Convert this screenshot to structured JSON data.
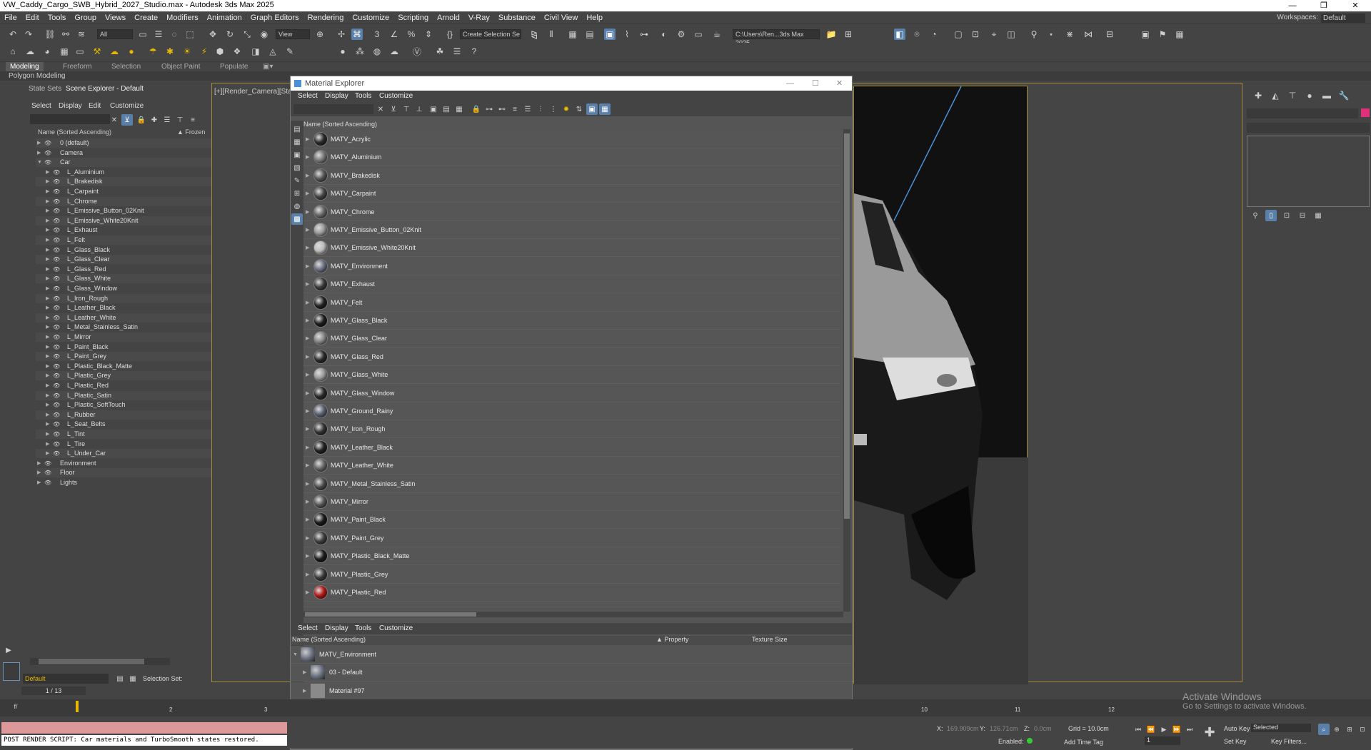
{
  "window": {
    "title": "VW_Caddy_Cargo_SWB_Hybrid_2027_Studio.max - Autodesk 3ds Max 2025"
  },
  "menubar": {
    "items": [
      "File",
      "Edit",
      "Tools",
      "Group",
      "Views",
      "Create",
      "Modifiers",
      "Animation",
      "Graph Editors",
      "Rendering",
      "Customize",
      "Scripting",
      "Arnold",
      "V-Ray",
      "Substance",
      "Civil View",
      "Help"
    ],
    "workspaces_label": "Workspaces:",
    "workspace_value": "Default"
  },
  "toolbar": {
    "selection_filter": "All",
    "ref_coord": "View",
    "named_sel": "Create Selection Se",
    "project_path": "C:\\Users\\Ren...3ds Max 2025"
  },
  "ribbon": {
    "tabs": [
      "Modeling",
      "Freeform",
      "Selection",
      "Object Paint",
      "Populate"
    ],
    "sub": "Polygon Modeling"
  },
  "scene_explorer": {
    "tabs": [
      "State Sets",
      "Scene Explorer - Default"
    ],
    "menu": [
      "Select",
      "Display",
      "Edit",
      "Customize"
    ],
    "col_name": "Name (Sorted Ascending)",
    "col_frozen": "▲ Frozen",
    "rows": [
      {
        "label": "0 (default)",
        "level": 1,
        "exp": "▶"
      },
      {
        "label": "Camera",
        "level": 1,
        "exp": "▶"
      },
      {
        "label": "Car",
        "level": 1,
        "exp": "▼"
      },
      {
        "label": "L_Aluminium",
        "level": 2,
        "exp": "▶"
      },
      {
        "label": "L_Brakedisk",
        "level": 2,
        "exp": "▶"
      },
      {
        "label": "L_Carpaint",
        "level": 2,
        "exp": "▶"
      },
      {
        "label": "L_Chrome",
        "level": 2,
        "exp": "▶"
      },
      {
        "label": "L_Emissive_Button_02Knit",
        "level": 2,
        "exp": "▶"
      },
      {
        "label": "L_Emissive_White20Knit",
        "level": 2,
        "exp": "▶"
      },
      {
        "label": "L_Exhaust",
        "level": 2,
        "exp": "▶"
      },
      {
        "label": "L_Felt",
        "level": 2,
        "exp": "▶"
      },
      {
        "label": "L_Glass_Black",
        "level": 2,
        "exp": "▶"
      },
      {
        "label": "L_Glass_Clear",
        "level": 2,
        "exp": "▶"
      },
      {
        "label": "L_Glass_Red",
        "level": 2,
        "exp": "▶"
      },
      {
        "label": "L_Glass_White",
        "level": 2,
        "exp": "▶"
      },
      {
        "label": "L_Glass_Window",
        "level": 2,
        "exp": "▶"
      },
      {
        "label": "L_Iron_Rough",
        "level": 2,
        "exp": "▶"
      },
      {
        "label": "L_Leather_Black",
        "level": 2,
        "exp": "▶"
      },
      {
        "label": "L_Leather_White",
        "level": 2,
        "exp": "▶"
      },
      {
        "label": "L_Metal_Stainless_Satin",
        "level": 2,
        "exp": "▶"
      },
      {
        "label": "L_Mirror",
        "level": 2,
        "exp": "▶"
      },
      {
        "label": "L_Paint_Black",
        "level": 2,
        "exp": "▶"
      },
      {
        "label": "L_Paint_Grey",
        "level": 2,
        "exp": "▶"
      },
      {
        "label": "L_Plastic_Black_Matte",
        "level": 2,
        "exp": "▶"
      },
      {
        "label": "L_Plastic_Grey",
        "level": 2,
        "exp": "▶"
      },
      {
        "label": "L_Plastic_Red",
        "level": 2,
        "exp": "▶"
      },
      {
        "label": "L_Plastic_Satin",
        "level": 2,
        "exp": "▶"
      },
      {
        "label": "L_Plastic_SoftTouch",
        "level": 2,
        "exp": "▶"
      },
      {
        "label": "L_Rubber",
        "level": 2,
        "exp": "▶"
      },
      {
        "label": "L_Seat_Belts",
        "level": 2,
        "exp": "▶"
      },
      {
        "label": "L_Tint",
        "level": 2,
        "exp": "▶"
      },
      {
        "label": "L_Tire",
        "level": 2,
        "exp": "▶"
      },
      {
        "label": "L_Under_Car",
        "level": 2,
        "exp": "▶"
      },
      {
        "label": "Environment",
        "level": 1,
        "exp": "▶"
      },
      {
        "label": "Floor",
        "level": 1,
        "exp": "▶"
      },
      {
        "label": "Lights",
        "level": 1,
        "exp": "▶"
      }
    ],
    "layer_value": "Default",
    "selection_set_label": "Selection Set:"
  },
  "viewport": {
    "label": "[+][Render_Camera][Stan"
  },
  "material_explorer": {
    "title": "Material Explorer",
    "menu": [
      "Select",
      "Display",
      "Tools",
      "Customize"
    ],
    "col_name": "Name (Sorted Ascending)",
    "materials": [
      {
        "name": "MATV_Acrylic",
        "color": "#2a2a2a"
      },
      {
        "name": "MATV_Aluminium",
        "color": "#777777"
      },
      {
        "name": "MATV_Brakedisk",
        "color": "#555555"
      },
      {
        "name": "MATV_Carpaint",
        "color": "#444444"
      },
      {
        "name": "MATV_Chrome",
        "color": "#666666"
      },
      {
        "name": "MATV_Emissive_Button_02Knit",
        "color": "#999999"
      },
      {
        "name": "MATV_Emissive_White20Knit",
        "color": "#bbbbbb"
      },
      {
        "name": "MATV_Environment",
        "color": "#6a7080"
      },
      {
        "name": "MATV_Exhaust",
        "color": "#3a3a3a"
      },
      {
        "name": "MATV_Felt",
        "color": "#222222"
      },
      {
        "name": "MATV_Glass_Black",
        "color": "#1e1e1e"
      },
      {
        "name": "MATV_Glass_Clear",
        "color": "#888888"
      },
      {
        "name": "MATV_Glass_Red",
        "color": "#2b2b2b"
      },
      {
        "name": "MATV_Glass_White",
        "color": "#9a9a9a"
      },
      {
        "name": "MATV_Glass_Window",
        "color": "#2a2a2a"
      },
      {
        "name": "MATV_Ground_Rainy",
        "color": "#5a6070"
      },
      {
        "name": "MATV_Iron_Rough",
        "color": "#333333"
      },
      {
        "name": "MATV_Leather_Black",
        "color": "#222222"
      },
      {
        "name": "MATV_Leather_White",
        "color": "#666666"
      },
      {
        "name": "MATV_Metal_Stainless_Satin",
        "color": "#4a4a4a"
      },
      {
        "name": "MATV_Mirror",
        "color": "#555555"
      },
      {
        "name": "MATV_Paint_Black",
        "color": "#1a1a1a"
      },
      {
        "name": "MATV_Paint_Grey",
        "color": "#3e3e3e"
      },
      {
        "name": "MATV_Plastic_Black_Matte",
        "color": "#1c1c1c"
      },
      {
        "name": "MATV_Plastic_Grey",
        "color": "#3a3a3a"
      },
      {
        "name": "MATV_Plastic_Red",
        "color": "#b01818"
      }
    ],
    "bottom_menu": [
      "Select",
      "Display",
      "Tools",
      "Customize"
    ],
    "bottom_cols": {
      "name": "Name (Sorted Ascending)",
      "property": "▲ Property",
      "texture": "Texture Size"
    },
    "bottom_rows": [
      {
        "name": "MATV_Environment",
        "exp": "▼"
      },
      {
        "name": "03 - Default",
        "exp": "▶"
      },
      {
        "name": "Material #97",
        "exp": "▶"
      }
    ]
  },
  "timeline": {
    "frame_counter": "1 / 13",
    "ticks": [
      "2",
      "3",
      "10",
      "11",
      "12"
    ]
  },
  "status": {
    "script_line": "POST RENDER SCRIPT: Car materials and TurboSmooth states restored.",
    "x_label": "X:",
    "x_val": "169.909cm",
    "y_label": "Y:",
    "y_val": "126.71cm",
    "z_label": "Z:",
    "z_val": "0.0cm",
    "grid": "Grid = 10.0cm",
    "enabled": "Enabled:",
    "add_time_tag": "Add Time Tag",
    "auto_key": "Auto Key",
    "set_key": "Set Key",
    "selected": "Selected",
    "key_filters": "Key Filters...",
    "frame": "1"
  },
  "activate": {
    "line1": "Activate Windows",
    "line2": "Go to Settings to activate Windows."
  }
}
